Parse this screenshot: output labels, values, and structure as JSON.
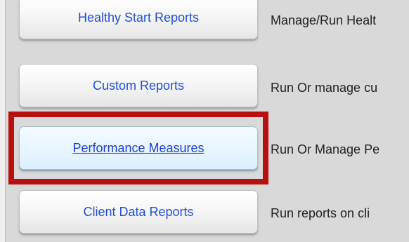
{
  "reports": [
    {
      "button_label": "Healthy Start Reports",
      "description": "Manage/Run Healt"
    },
    {
      "button_label": "Custom Reports",
      "description": "Run Or manage cu"
    },
    {
      "button_label": "Performance Measures",
      "description": "Run Or Manage Pe"
    },
    {
      "button_label": "Client Data Reports",
      "description": "Run reports on cli"
    }
  ],
  "highlight_color": "#b80f0f",
  "button_text_color": "#1f4fd6"
}
